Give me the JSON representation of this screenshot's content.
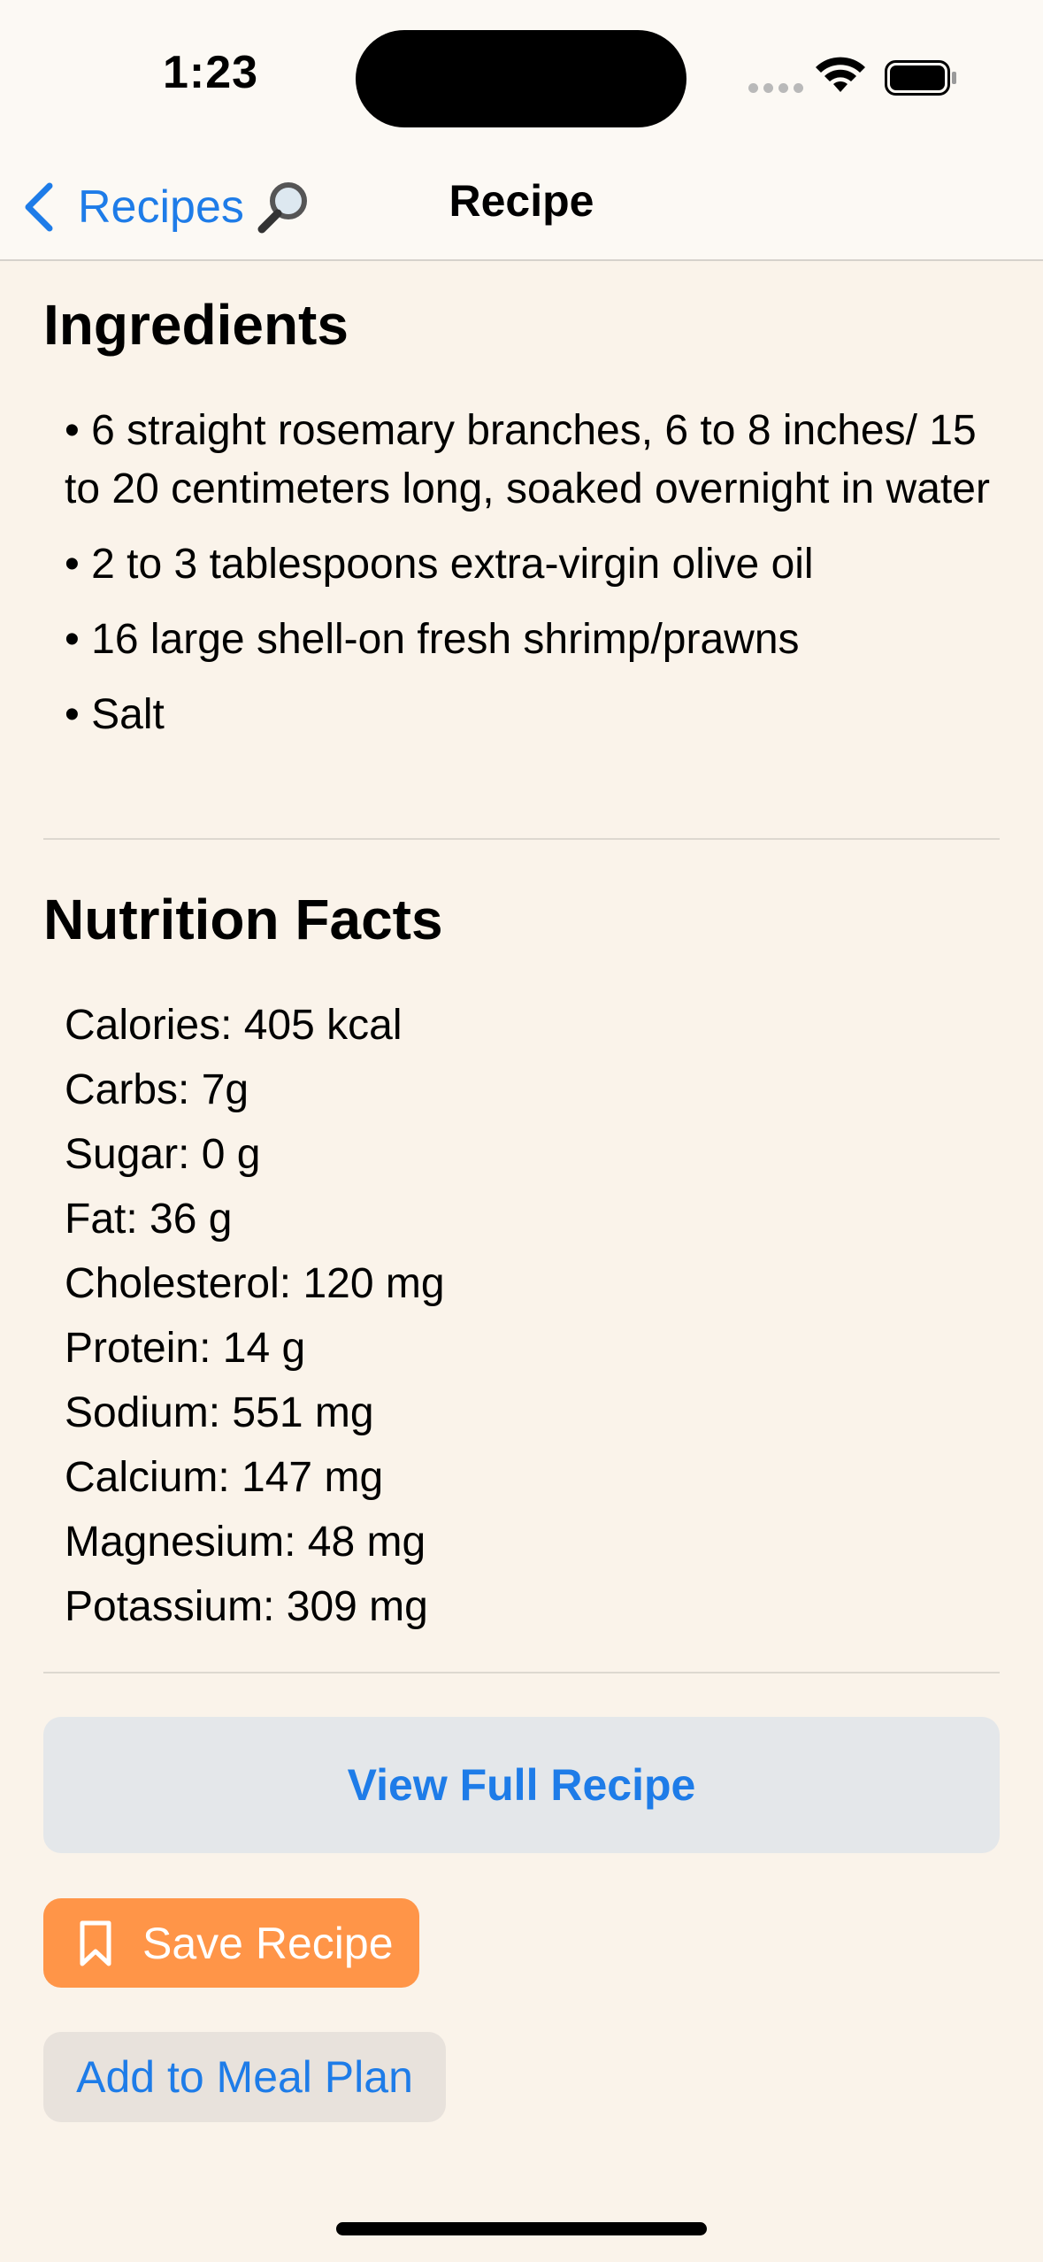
{
  "status_bar": {
    "time": "1:23"
  },
  "nav": {
    "back_label": "Recipes",
    "title": "Recipe"
  },
  "ingredients": {
    "title": "Ingredients",
    "items": [
      "• 6 straight rosemary branches, 6 to 8 inches/ 15 to 20 centimeters long, soaked overnight in water",
      "• 2 to 3 tablespoons extra-virgin olive oil",
      "• 16 large shell-on fresh shrimp/prawns",
      "• Salt"
    ]
  },
  "nutrition": {
    "title": "Nutrition Facts",
    "items": [
      "Calories: 405 kcal",
      "Carbs: 7g",
      "Sugar: 0 g",
      "Fat: 36 g",
      "Cholesterol: 120 mg",
      "Protein: 14 g",
      "Sodium: 551 mg",
      "Calcium: 147 mg",
      "Magnesium: 48 mg",
      "Potassium: 309 mg"
    ]
  },
  "actions": {
    "view_full_label": "View Full Recipe",
    "save_label": "Save Recipe",
    "meal_plan_label": "Add to Meal Plan"
  },
  "colors": {
    "accent": "#1E7CE8",
    "save_button": "#FF9548",
    "background": "#FAF3EA"
  },
  "icons": {
    "back": "chevron-left-icon",
    "search": "magnifier-icon",
    "save": "bookmark-icon",
    "wifi": "wifi-icon",
    "battery": "battery-icon"
  }
}
